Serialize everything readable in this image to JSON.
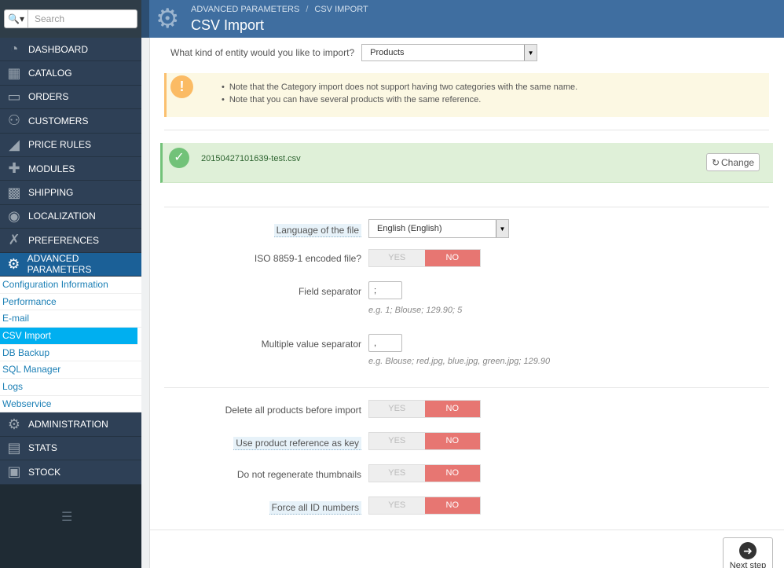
{
  "search": {
    "placeholder": "Search",
    "icon": "search-icon"
  },
  "sidebar": {
    "items": [
      {
        "label": "DASHBOARD",
        "icon": "dashboard-icon"
      },
      {
        "label": "CATALOG",
        "icon": "book-icon"
      },
      {
        "label": "ORDERS",
        "icon": "credit-card-icon"
      },
      {
        "label": "CUSTOMERS",
        "icon": "users-icon"
      },
      {
        "label": "PRICE RULES",
        "icon": "tag-icon"
      },
      {
        "label": "MODULES",
        "icon": "puzzle-icon"
      },
      {
        "label": "SHIPPING",
        "icon": "truck-icon"
      },
      {
        "label": "LOCALIZATION",
        "icon": "globe-icon"
      },
      {
        "label": "PREFERENCES",
        "icon": "wrench-icon"
      },
      {
        "label": "ADVANCED PARAMETERS",
        "icon": "cogs-icon"
      }
    ],
    "submenu": [
      "Configuration Information",
      "Performance",
      "E-mail",
      "CSV Import",
      "DB Backup",
      "SQL Manager",
      "Logs",
      "Webservice"
    ],
    "items_bottom": [
      {
        "label": "ADMINISTRATION",
        "icon": "cog-icon"
      },
      {
        "label": "STATS",
        "icon": "bar-chart-icon"
      },
      {
        "label": "STOCK",
        "icon": "archive-icon"
      }
    ]
  },
  "header": {
    "breadcrumb_1": "ADVANCED PARAMETERS",
    "breadcrumb_sep": "/",
    "breadcrumb_2": "CSV IMPORT",
    "title": "CSV Import"
  },
  "entity": {
    "label": "What kind of entity would you like to import?",
    "value": "Products"
  },
  "warning": {
    "icon": "!",
    "notes": [
      "Note that the Category import does not support having two categories with the same name.",
      "Note that you can have several products with the same reference."
    ]
  },
  "file": {
    "name": "20150427101639-test.csv",
    "change_label": "Change"
  },
  "form": {
    "language_label": "Language of the file",
    "language_value": "English (English)",
    "iso_label": "ISO 8859-1 encoded file?",
    "field_sep_label": "Field separator",
    "field_sep_value": ";",
    "field_sep_help": "e.g. 1; Blouse; 129.90; 5",
    "multi_sep_label": "Multiple value separator",
    "multi_sep_value": ",",
    "multi_sep_help": "e.g. Blouse; red.jpg, blue.jpg, green.jpg; 129.90",
    "delete_label": "Delete all products before import",
    "ref_key_label": "Use product reference as key",
    "no_regen_label": "Do not regenerate thumbnails",
    "force_id_label": "Force all ID numbers",
    "yes": "YES",
    "no": "NO"
  },
  "next_step": "Next step",
  "colors": {
    "header": "#3f6ea0",
    "active_menu": "#1b6097",
    "active_submenu": "#00aff0",
    "toggle_no": "#e77672",
    "warning": "#fcf8e3",
    "success": "#dff0d8"
  }
}
